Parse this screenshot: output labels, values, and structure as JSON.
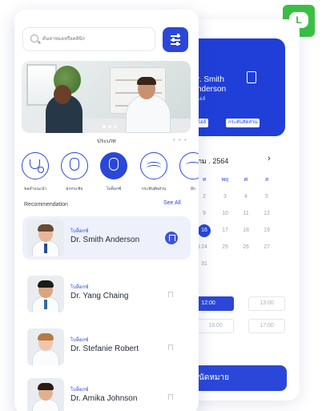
{
  "back": {
    "doctor_name_1": "r. Smith",
    "doctor_name_2": "nderson",
    "doctor_spec": "ไอล์",
    "tags": [
      "ไอล์",
      "กระดับสัดส่วน"
    ],
    "month": "ภม . 2564",
    "weekdays": [
      "ท",
      "พฤ",
      "ศ",
      "ส"
    ],
    "calendar_rows": [
      [
        "2",
        "3",
        "4",
        "5"
      ],
      [
        "9",
        "10",
        "11",
        "12"
      ],
      [
        "16",
        "17",
        "18",
        "19"
      ],
      [
        "23",
        "24",
        "25",
        "26",
        "27"
      ],
      [
        "31"
      ]
    ],
    "selected_day": "16",
    "slots": [
      "12:00",
      "13:00",
      "16:00",
      "17:00"
    ],
    "book_label": "อนัดหมาย",
    "line_label": "L"
  },
  "front": {
    "search": {
      "placeholder": "ค้นหาหมอหรือคลินิก"
    },
    "category_title": "ประเภท",
    "category_more": "• • •",
    "categories": [
      {
        "label": "ขอคำแนะนำ",
        "icon": "stethoscope-icon"
      },
      {
        "label": "ยกกระชับ",
        "icon": "face-icon"
      },
      {
        "label": "โบท็อกซ์",
        "icon": "face-icon",
        "selected": true
      },
      {
        "label": "กระชับสัดส่วน",
        "icon": "wave-icon"
      },
      {
        "label": "ยัก",
        "icon": "wave-icon"
      }
    ],
    "recommendation_label": "Recommendation",
    "see_all": "See All",
    "doctors": [
      {
        "specialty": "โบท็อกซ์",
        "name": "Dr. Smith Anderson",
        "bookmarked": true
      },
      {
        "specialty": "โบท็อกซ์",
        "name": "Dr. Yang Chaing",
        "bookmarked": false
      },
      {
        "specialty": "โบท็อกซ์",
        "name": "Dr. Stefanie Robert",
        "bookmarked": false
      },
      {
        "specialty": "โบท็อกซ์",
        "name": "Dr. Amika Johnson",
        "bookmarked": false
      }
    ]
  },
  "colors": {
    "accent": "#2a47d9",
    "line_green": "#39c043",
    "selected_card": "#eef1fb"
  }
}
